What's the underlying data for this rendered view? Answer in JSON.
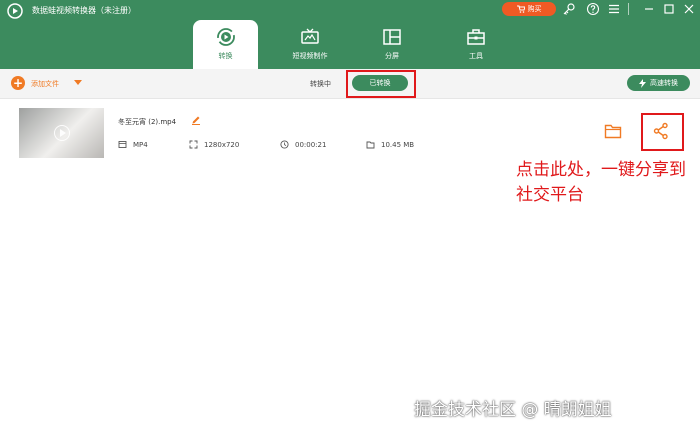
{
  "window": {
    "title": "数据蛙视频转换器（未注册）"
  },
  "header": {
    "buy_label": "购买",
    "icons": [
      "key-icon",
      "help-icon",
      "menu-icon",
      "minimize-icon",
      "maximize-icon",
      "close-icon"
    ],
    "tabs": [
      {
        "label": "转换",
        "icon": "convert-icon",
        "active": true
      },
      {
        "label": "短视频制作",
        "icon": "tv-icon",
        "active": false
      },
      {
        "label": "分屏",
        "icon": "split-screen-icon",
        "active": false
      },
      {
        "label": "工具",
        "icon": "toolbox-icon",
        "active": false
      }
    ]
  },
  "toolbar": {
    "add_file_label": "添加文件",
    "converting_label": "转换中",
    "converted_label": "已转换",
    "fast_convert_label": "高速转换"
  },
  "file": {
    "name": "冬至元宵 (2).mp4",
    "format": "MP4",
    "resolution": "1280x720",
    "duration": "00:00:21",
    "size": "10.45 MB"
  },
  "annotation": "点击此处，一键分享到社交平台",
  "watermark": "掘金技术社区 @ 晴朗姐姐",
  "colors": {
    "brand_green": "#3c8b5e",
    "orange": "#f07a24",
    "highlight_red": "#e0191b"
  }
}
